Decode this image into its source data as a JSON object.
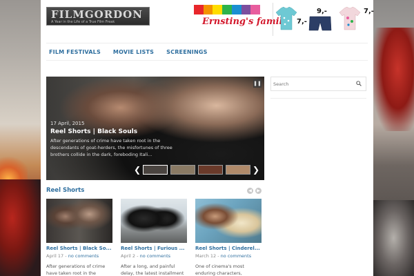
{
  "site": {
    "logo_text": "FILMGORDON",
    "tagline": "A Year in the Life of a True Film Freak"
  },
  "ad": {
    "brand": "Ernsting's family",
    "stripe_colors": [
      "#e8262b",
      "#f39200",
      "#ffdd00",
      "#2db34a",
      "#1a8fd1",
      "#7c4e9e",
      "#e85d9e"
    ],
    "items": [
      {
        "price": "7,-",
        "color": "#6ec9d4"
      },
      {
        "price": "9,-",
        "color": "#2c3e66"
      },
      {
        "price": "7,-",
        "color": "#f2b4bf"
      }
    ]
  },
  "nav": {
    "items": [
      "FILM FESTIVALS",
      "MOVIE LISTS",
      "SCREENINGS"
    ]
  },
  "slider": {
    "date": "17 April, 2015",
    "title": "Reel Shorts | Black Souls",
    "excerpt": "After generations of crime have taken root in the descendants of goat-herders, the misfortunes of three brothers collide in the dark, foreboding Itali...",
    "pause_icon": "pause-icon",
    "thumbs": [
      {
        "color": "#4a4440"
      },
      {
        "color": "#8a7a64"
      },
      {
        "color": "#6a3a2a"
      },
      {
        "color": "#b08a6a"
      }
    ]
  },
  "section": {
    "title": "Reel Shorts"
  },
  "cards": [
    {
      "title": "Reel Shorts | Black So...",
      "date": "April 17",
      "separator": "-",
      "comments": "no comments",
      "excerpt": "After generations of crime have taken root in the"
    },
    {
      "title": "Reel Shorts | Furious ...",
      "date": "April 2",
      "separator": "-",
      "comments": "no comments",
      "excerpt": "After a long, and painful delay, the latest installment"
    },
    {
      "title": "Reel Shorts | Cinderel...",
      "date": "March 12",
      "separator": "-",
      "comments": "no comments",
      "excerpt": "One of cinema's most enduring characters,"
    }
  ],
  "sidebar": {
    "search_placeholder": "Search"
  },
  "colors": {
    "link": "#2f6f9f",
    "ad_brand": "#d3182c"
  }
}
